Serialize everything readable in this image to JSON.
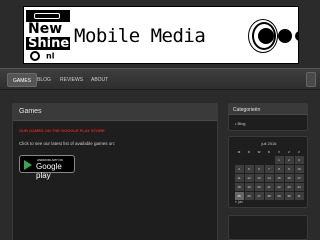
{
  "banner": {
    "logo_line1": "New",
    "logo_line2": "Shine",
    "logo_line3": "nl",
    "title": "Mobile Media"
  },
  "nav": {
    "items": [
      {
        "label": "GAMES",
        "active": true
      },
      {
        "label": "BLOG",
        "active": false
      },
      {
        "label": "REVIEWS",
        "active": false
      },
      {
        "label": "ABOUT",
        "active": false
      }
    ]
  },
  "main": {
    "title": "Games",
    "subtitle": "OUR GAMES ON THE GOOGLE PLAY STORE",
    "text": "Click to see our latest list of available games on:",
    "badge_small": "ANDROID APP ON",
    "badge_big": "Google play"
  },
  "sidebar": {
    "categories_title": "Categorieën",
    "categories": [
      "Blog"
    ],
    "calendar": {
      "month": "juli 2016",
      "weekdays": [
        "M",
        "D",
        "W",
        "D",
        "V",
        "Z",
        "Z"
      ],
      "days": [
        "",
        "",
        "",
        "",
        "1",
        "2",
        "3",
        "4",
        "5",
        "6",
        "7",
        "8",
        "9",
        "10",
        "11",
        "12",
        "13",
        "14",
        "15",
        "16",
        "17",
        "18",
        "19",
        "20",
        "21",
        "22",
        "23",
        "24",
        "25",
        "26",
        "27",
        "28",
        "29",
        "30",
        "31"
      ],
      "today": "25",
      "prev_link": "« jun"
    }
  },
  "colors": {
    "background": "#2b2b2b",
    "panel": "#1e1e1e",
    "panel_header": "#3a3a3a",
    "accent_red": "#e0271a"
  }
}
